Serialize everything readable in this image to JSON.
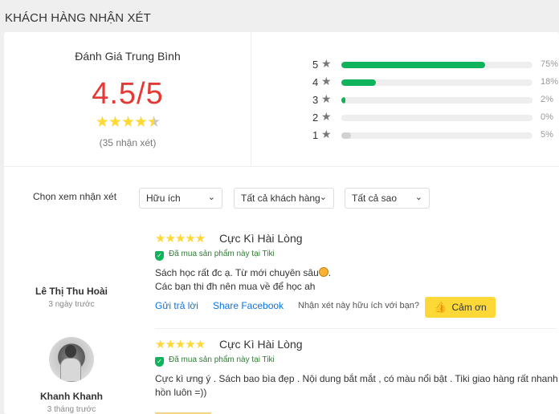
{
  "section": {
    "title": "KHÁCH HÀNG NHẬN XÉT"
  },
  "summary": {
    "average_title": "Đánh Giá Trung Bình",
    "average_score": "4.5/5",
    "rating_value": 4.5,
    "review_count_text": "(35 nhận xét)",
    "distribution": [
      {
        "stars": "5",
        "percent_text": "75%",
        "fraction": 0.75
      },
      {
        "stars": "4",
        "percent_text": "18%",
        "fraction": 0.18
      },
      {
        "stars": "3",
        "percent_text": "2%",
        "fraction": 0.02
      },
      {
        "stars": "2",
        "percent_text": "0%",
        "fraction": 0.0
      },
      {
        "stars": "1",
        "percent_text": "5%",
        "fraction": 0.05
      }
    ]
  },
  "filters": {
    "label": "Chọn xem nhận xét",
    "sort": "Hữu ích",
    "customers": "Tất cả khách hàng",
    "stars": "Tất cả sao"
  },
  "reviews": [
    {
      "name": "Lê Thị Thu Hoài",
      "time": "3 ngày trước",
      "rating": 5,
      "title": "Cực Kì Hài Lòng",
      "verified": "Đã mua sản phẩm này tại Tiki",
      "text_line1": "Sách học rất đc ạ. Từ mới chuyên sâu",
      "text_line2": "Các bạn thi đh nên mua về để học ah",
      "reply": "Gửi trả lời",
      "share": "Share Facebook",
      "helpful_question": "Nhận xét này hữu ích với bạn?",
      "thanks": "Cảm ơn"
    },
    {
      "name": "Khanh Khanh",
      "time": "3 tháng trước",
      "rating": 5,
      "title": "Cực Kì Hài Lòng",
      "verified": "Đã mua sản phẩm này tại Tiki",
      "text_line1": "Cực kì ưng ý . Sách bao bìa đẹp . Nội dung bắt mắt , có màu nổi bật . Tiki giao hàng rất nhanh .",
      "text_line2": "hồn luôn =))"
    }
  ],
  "colors": {
    "score": "#e53935",
    "star": "#fdd836",
    "bar": "#0fb35c",
    "link": "#0b74e5",
    "thanks_button": "#fdd836"
  },
  "icons": [
    "star-icon",
    "chevron-down-icon",
    "shield-check-icon",
    "thumbs-up-icon",
    "avatar"
  ]
}
